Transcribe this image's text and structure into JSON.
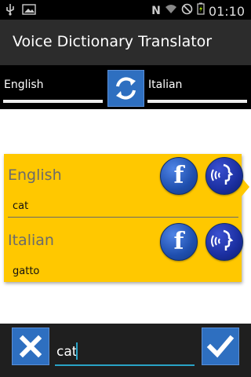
{
  "status_bar": {
    "time": "01:10",
    "icons": [
      "usb-icon",
      "image-icon",
      "nfc-icon",
      "wifi-icon",
      "no-sim-icon",
      "battery-charging-icon"
    ]
  },
  "app": {
    "title": "Voice Dictionary Translator"
  },
  "language_bar": {
    "source_language": "English",
    "target_language": "Italian",
    "swap_icon": "swap-icon"
  },
  "result_card": {
    "source": {
      "language": "English",
      "word": "cat"
    },
    "target": {
      "language": "Italian",
      "word": "gatto"
    },
    "share_icon": "facebook-icon",
    "speak_icon": "speaker-icon"
  },
  "bottom_bar": {
    "input_value": "cat",
    "cancel_icon": "close-icon",
    "ok_icon": "check-icon"
  },
  "colors": {
    "accent_blue": "#2e6fc0",
    "card_yellow": "#ffc800",
    "input_underline": "#29a3c6"
  }
}
